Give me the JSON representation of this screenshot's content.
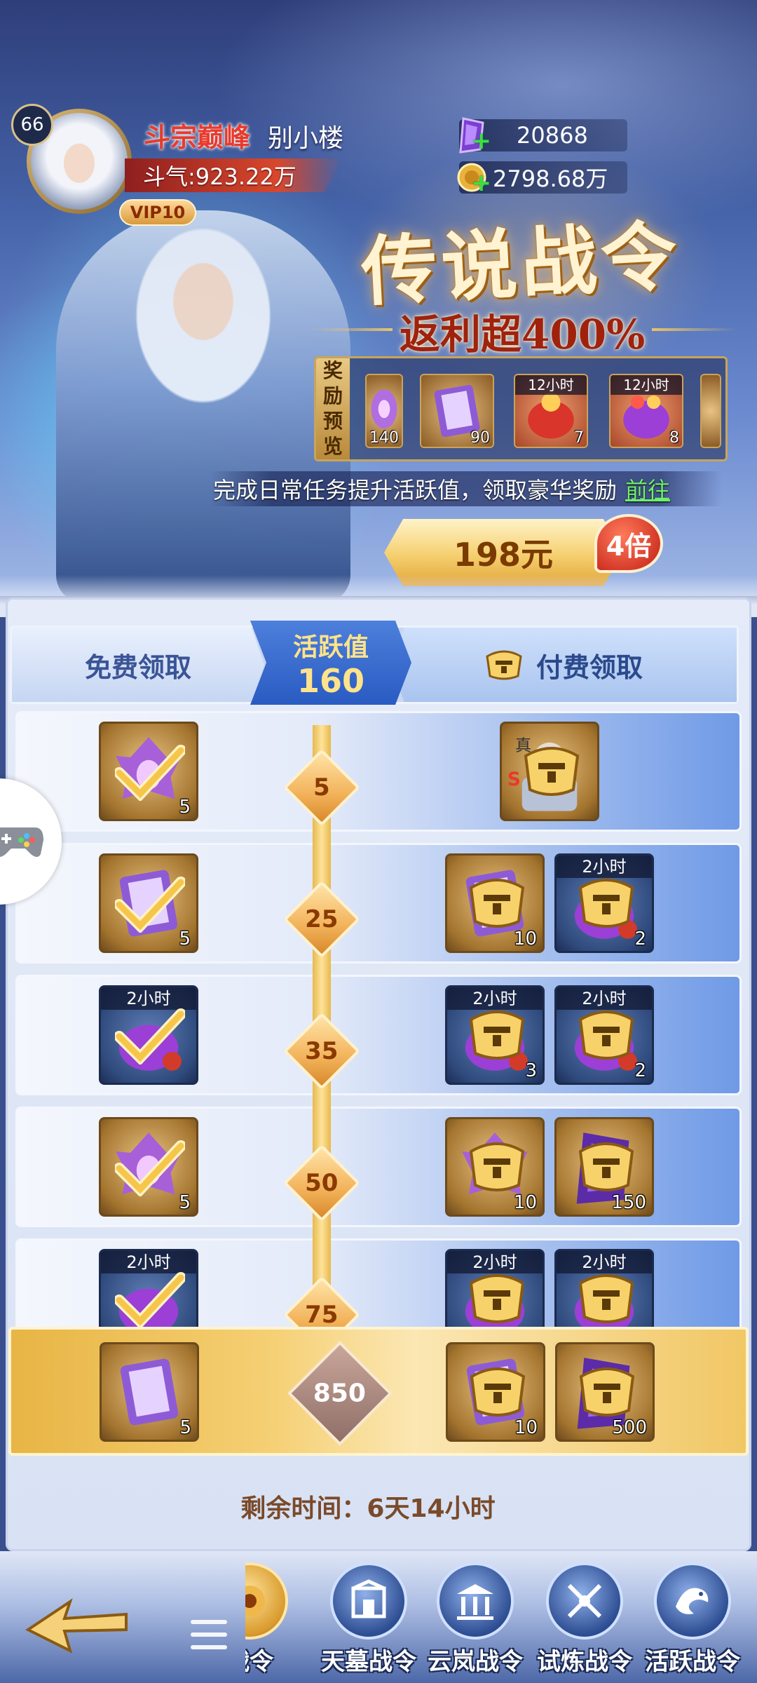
{
  "player": {
    "level": "66",
    "rank_title": "斗宗巅峰",
    "name": "别小楼",
    "power": "斗气:923.22万",
    "vip": "VIP10"
  },
  "currency": [
    {
      "icon": "purple-crystal-icon",
      "value": "20868"
    },
    {
      "icon": "gold-coin-icon",
      "value": "2798.68万"
    }
  ],
  "banner": {
    "title": "传说战令",
    "subtitle": "返利超400%",
    "preview_label": [
      "奖",
      "励",
      "预",
      "览"
    ],
    "preview_items": [
      {
        "icon": "purple-flower-icon",
        "count": "140",
        "tag": ""
      },
      {
        "icon": "skill-book-icon",
        "count": "90",
        "tag": ""
      },
      {
        "icon": "red-treasure-bag-icon",
        "count": "7",
        "tag": "12小时"
      },
      {
        "icon": "purple-treasure-bag-icon",
        "count": "8",
        "tag": "12小时"
      }
    ],
    "task_hint": "完成日常任务提升活跃值，领取豪华奖励",
    "task_link": "前往",
    "price": "198元",
    "multiplier": "4倍"
  },
  "tabs": {
    "free": "免费领取",
    "activity_label": "活跃值",
    "activity_value": "160",
    "paid": "付费领取"
  },
  "rows": [
    {
      "threshold": "5",
      "free": {
        "icon": "purple-flower-icon",
        "count": "5",
        "tag": "",
        "claimed": true,
        "style": "gold"
      },
      "paid": [
        {
          "icon": "character-card-icon",
          "count": "",
          "tag": "",
          "locked": true,
          "style": "gold"
        }
      ]
    },
    {
      "threshold": "25",
      "free": {
        "icon": "skill-book-icon",
        "count": "5",
        "tag": "",
        "claimed": true,
        "style": "gold"
      },
      "paid": [
        {
          "icon": "skill-book-icon",
          "count": "10",
          "tag": "",
          "locked": true,
          "style": "gold"
        },
        {
          "icon": "treasure-bag-icon",
          "count": "2",
          "tag": "2小时",
          "locked": true,
          "style": "blue"
        }
      ]
    },
    {
      "threshold": "35",
      "free": {
        "icon": "treasure-bag-icon",
        "count": "",
        "tag": "2小时",
        "claimed": true,
        "style": "blue"
      },
      "paid": [
        {
          "icon": "treasure-bag-icon",
          "count": "3",
          "tag": "2小时",
          "locked": true,
          "style": "blue"
        },
        {
          "icon": "treasure-bag-icon",
          "count": "2",
          "tag": "2小时",
          "locked": true,
          "style": "blue"
        }
      ]
    },
    {
      "threshold": "50",
      "free": {
        "icon": "purple-flower-icon",
        "count": "5",
        "tag": "",
        "claimed": true,
        "style": "gold"
      },
      "paid": [
        {
          "icon": "purple-flower-icon",
          "count": "10",
          "tag": "",
          "locked": true,
          "style": "gold"
        },
        {
          "icon": "purple-crystal-icon",
          "count": "150",
          "tag": "",
          "locked": true,
          "style": "gold"
        }
      ]
    },
    {
      "threshold": "75",
      "free": {
        "icon": "treasure-bag-icon",
        "count": "",
        "tag": "2小时",
        "claimed": true,
        "style": "blue"
      },
      "paid": [
        {
          "icon": "treasure-bag-icon",
          "count": "",
          "tag": "2小时",
          "locked": true,
          "style": "blue"
        },
        {
          "icon": "treasure-bag-icon",
          "count": "",
          "tag": "2小时",
          "locked": true,
          "style": "blue"
        }
      ]
    }
  ],
  "final_row": {
    "threshold": "850",
    "free": {
      "icon": "skill-book-icon",
      "count": "5"
    },
    "paid": [
      {
        "icon": "skill-book-icon",
        "count": "10"
      },
      {
        "icon": "purple-crystal-icon",
        "count": "500"
      }
    ]
  },
  "remaining_time": "剩余时间：6天14小时",
  "bottom_nav": [
    {
      "label": "战令",
      "icon": "legend-pass-icon"
    },
    {
      "label": "天墓战令",
      "icon": "tomb-gate-icon"
    },
    {
      "label": "云岚战令",
      "icon": "temple-icon"
    },
    {
      "label": "试炼战令",
      "icon": "crossed-swords-icon"
    },
    {
      "label": "活跃战令",
      "icon": "dragon-icon"
    }
  ],
  "colors": {
    "accent_gold": "#f2b25a",
    "tab_active": "#2a5bc2",
    "claim_check": "#ffd76a",
    "task_link": "#6ef06a"
  }
}
